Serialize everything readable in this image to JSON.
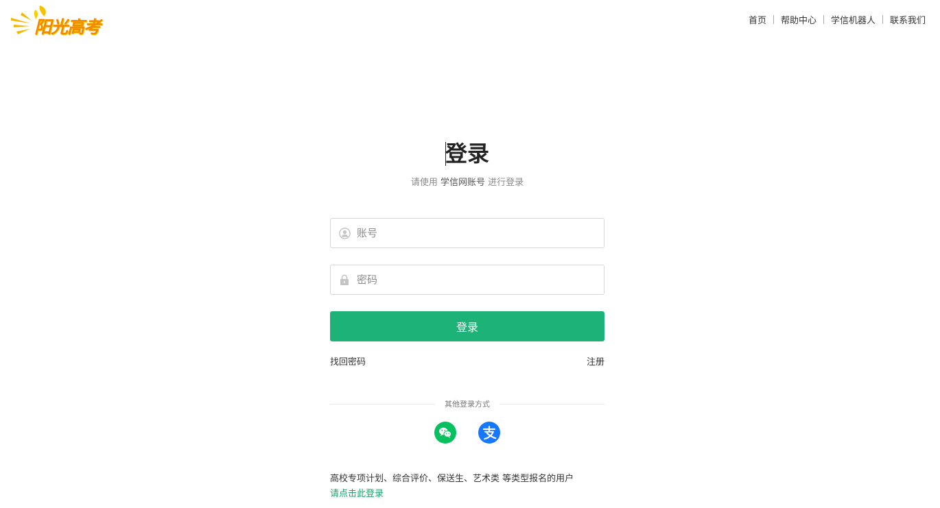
{
  "logo": {
    "text": "阳光高考",
    "icon": "sun-rays-logo"
  },
  "topnav": {
    "items": [
      {
        "label": "首页"
      },
      {
        "label": "帮助中心"
      },
      {
        "label": "学信机器人"
      },
      {
        "label": "联系我们"
      }
    ]
  },
  "login": {
    "title": "登录",
    "subtitle_prefix": "请使用",
    "subtitle_strong": "学信网账号",
    "subtitle_suffix": "进行登录",
    "account_placeholder": "账号",
    "account_icon": "user-circle-icon",
    "password_placeholder": "密码",
    "password_icon": "lock-icon",
    "submit_label": "登录",
    "forgot_label": "找回密码",
    "register_label": "注册",
    "other_methods_label": "其他登录方式",
    "social": [
      {
        "name": "wechat",
        "icon": "wechat-icon",
        "color": "#07c160"
      },
      {
        "name": "alipay",
        "icon": "alipay-icon",
        "color": "#1677ff"
      }
    ],
    "note_text": "高校专项计划、综合评价、保送生、艺术类 等类型报名的用户",
    "note_link": "请点击此登录"
  },
  "colors": {
    "accent": "#1db277",
    "link_green": "#1aa56b",
    "logo_orange": "#f08a00"
  }
}
